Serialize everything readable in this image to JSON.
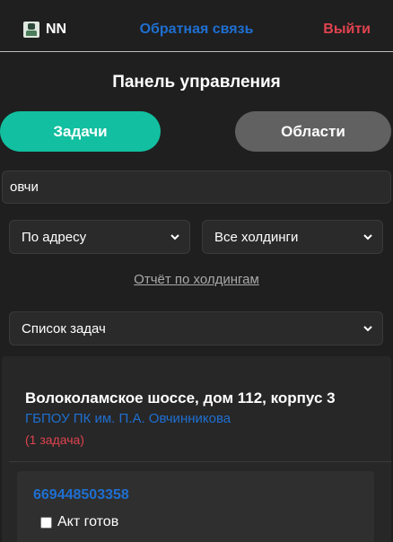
{
  "header": {
    "brand": "NN",
    "feedback": "Обратная связь",
    "logout": "Выйти"
  },
  "panel": {
    "title": "Панель управления"
  },
  "tabs": [
    {
      "label": "Задачи",
      "active": true
    },
    {
      "label": "Области",
      "active": false
    }
  ],
  "search": {
    "value": "овчи"
  },
  "filters": {
    "search_by": "По адресу",
    "holding": "Все холдинги",
    "view": "Список задач"
  },
  "report_link": "Отчёт по холдингам",
  "result": {
    "address": "Волоколамское шоссе, дом 112, корпус 3",
    "organization": "ГБПОУ ПК им. П.А. Овчинникова",
    "task_count": "(1 задача)",
    "task": {
      "id": "669448503358",
      "checkbox_label": "Акт готов",
      "checked": false
    }
  },
  "colors": {
    "background": "#1f1f1f",
    "accent": "#12bfa0",
    "link": "#1f6fd1",
    "danger": "#e0434f"
  }
}
